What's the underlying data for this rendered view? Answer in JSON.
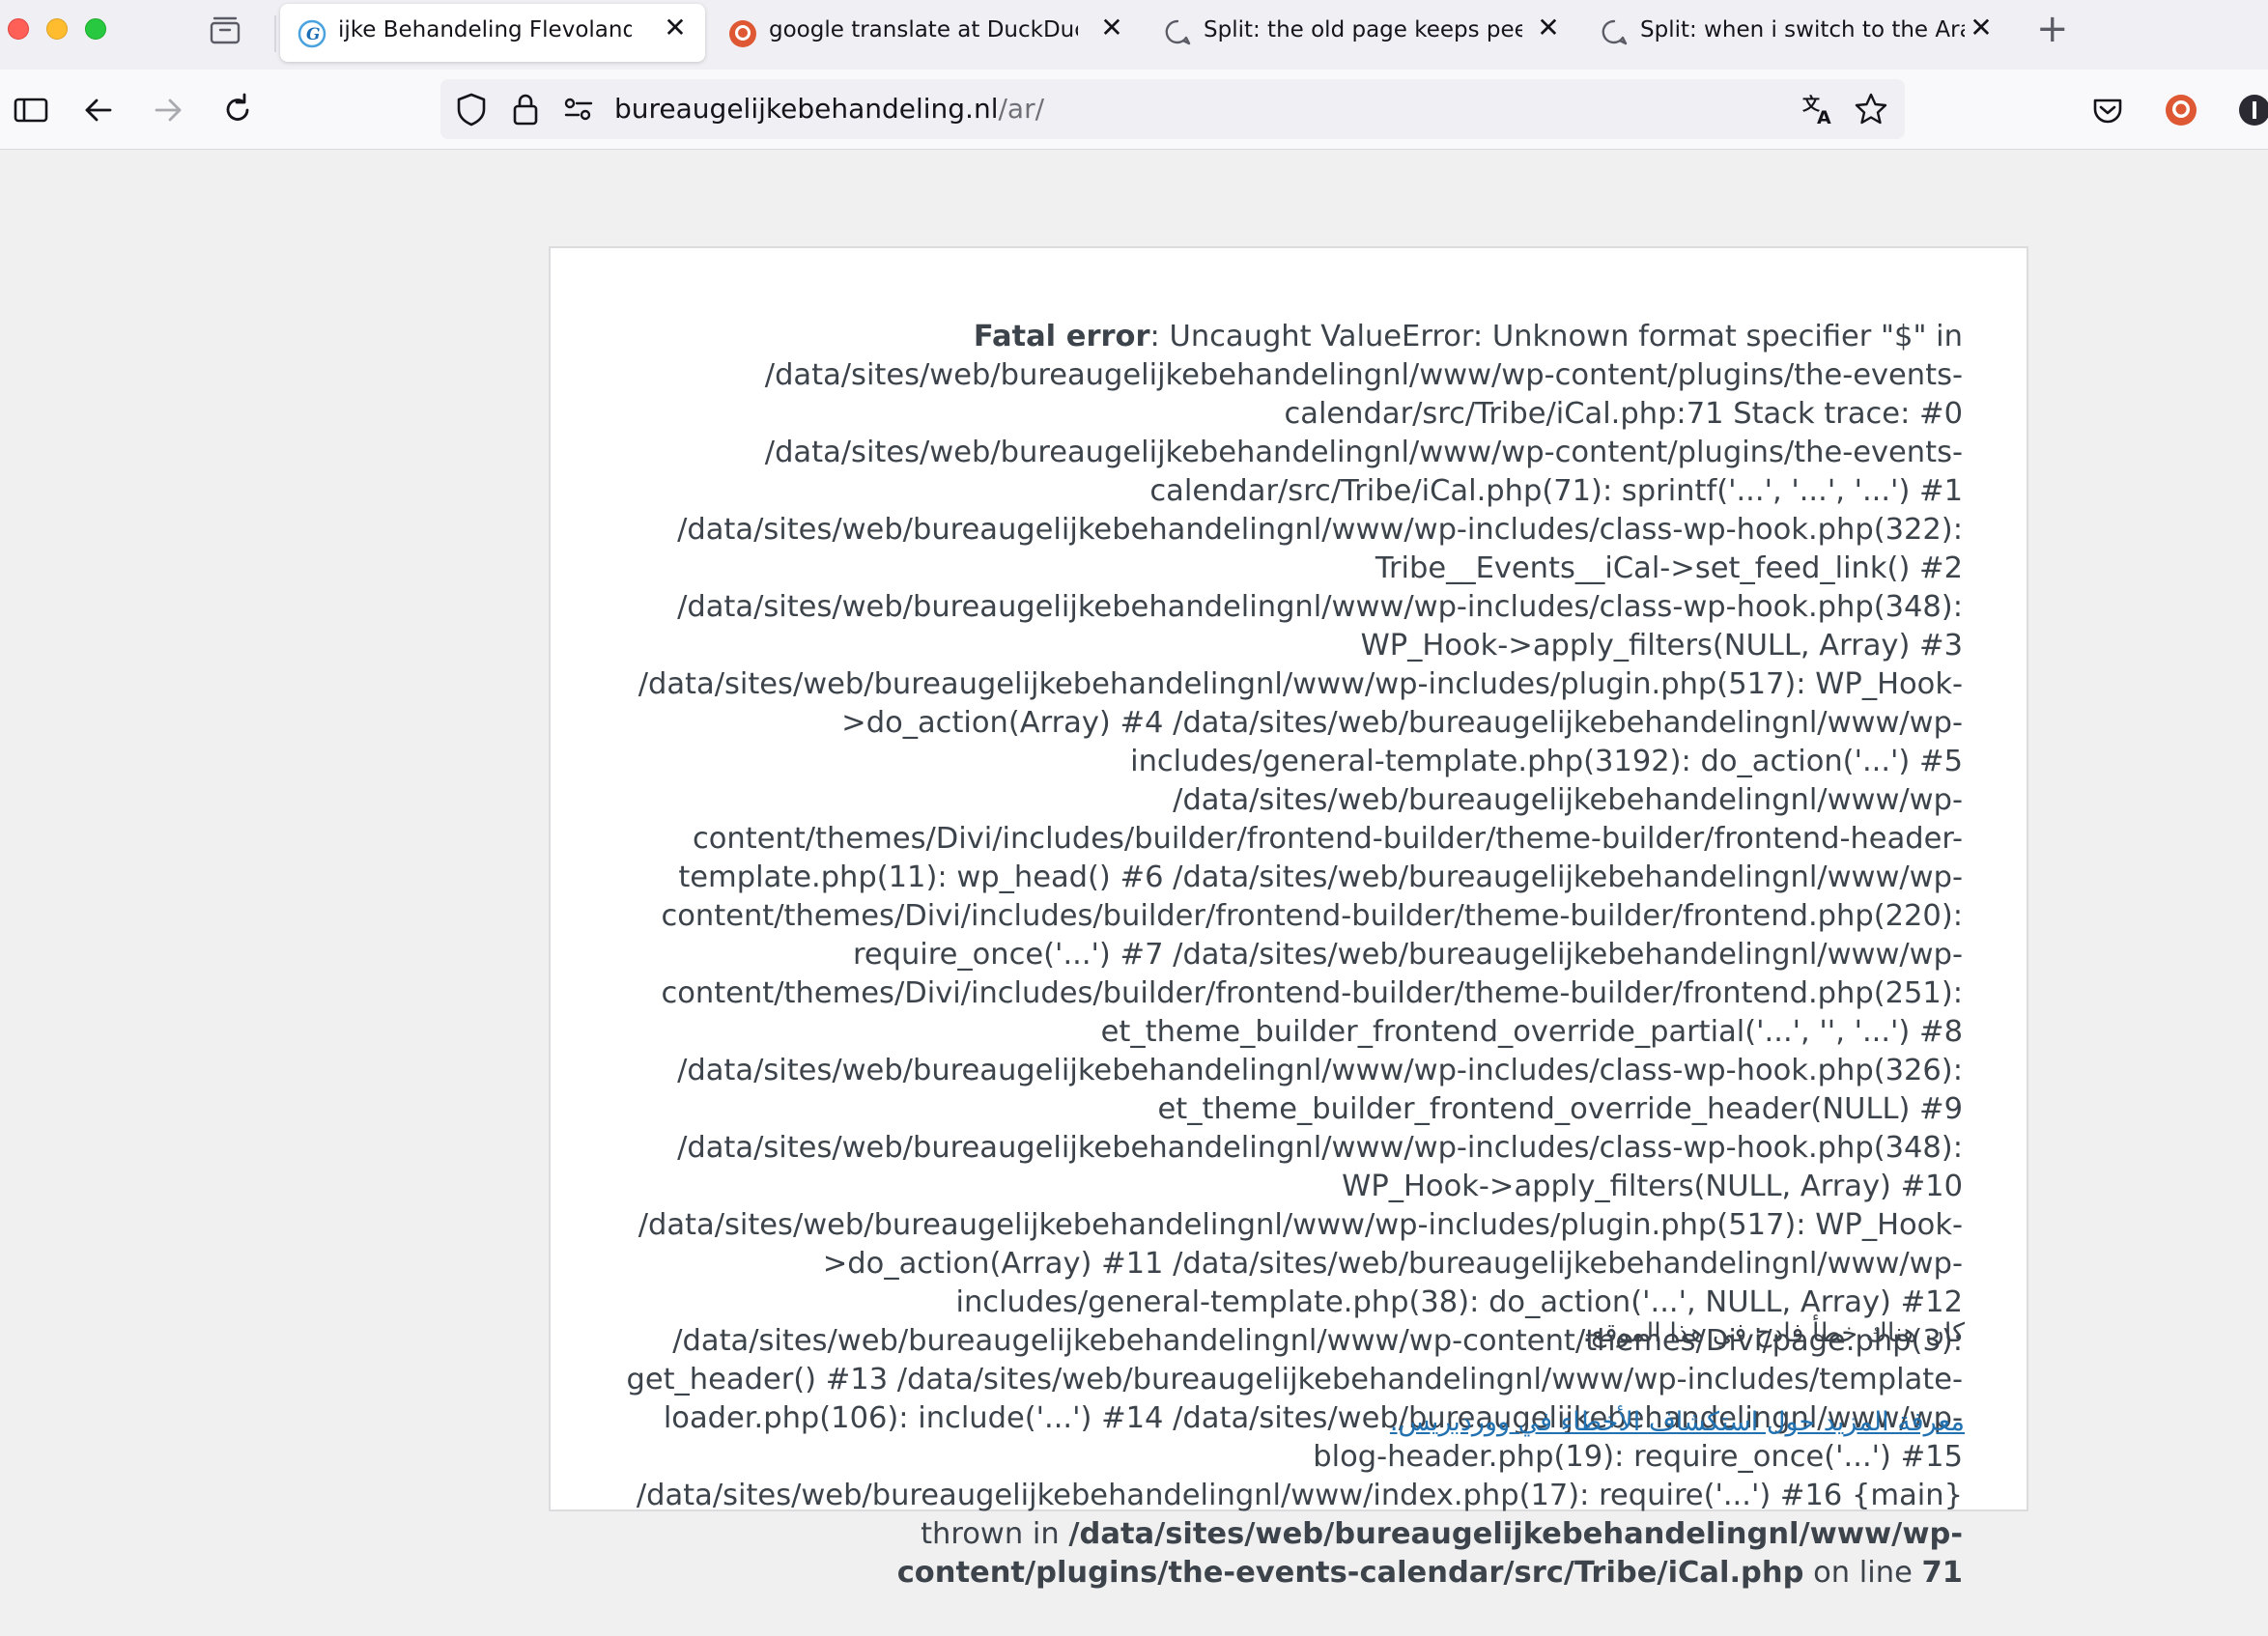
{
  "browser": {
    "tabs": [
      {
        "title": "ijke Behandeling Flevoland - بيت",
        "active": true
      },
      {
        "title": "google translate at DuckDuckGo",
        "active": false
      },
      {
        "title": "Split: the old page keeps peeping",
        "active": false
      },
      {
        "title": "Split: when i switch to the Arabic",
        "active": false
      }
    ],
    "new_tab_label": "+",
    "close_glyph": "✕",
    "url_domain": "bureaugelijkebehandeling.nl",
    "url_path": "/ar/"
  },
  "colors": {
    "accent_link": "#2271b1",
    "text": "#3c434a",
    "duckduckgo": "#de5833"
  },
  "icons": [
    "tab-overview-icon",
    "sidebar-icon",
    "back-icon",
    "forward-icon",
    "reload-icon",
    "shield-icon",
    "lock-icon",
    "permissions-icon",
    "translate-icon",
    "bookmark-star-icon",
    "pocket-icon",
    "duckduckgo-icon",
    "account-icon"
  ],
  "error": {
    "label": "Fatal error",
    "message": ": Uncaught ValueError: Unknown format specifier \"$\" in /data/sites/web/bureaugelijkebehandelingnl/www/wp-content/plugins/the-events-calendar/src/Tribe/iCal.php:71 Stack trace: #0 /data/sites/web/bureaugelijkebehandelingnl/www/wp-content/plugins/the-events-calendar/src/Tribe/iCal.php(71): sprintf('...', '...', '...') #1 /data/sites/web/bureaugelijkebehandelingnl/www/wp-includes/class-wp-hook.php(322): Tribe__Events__iCal->set_feed_link() #2 /data/sites/web/bureaugelijkebehandelingnl/www/wp-includes/class-wp-hook.php(348): WP_Hook->apply_filters(NULL, Array) #3 /data/sites/web/bureaugelijkebehandelingnl/www/wp-includes/plugin.php(517): WP_Hook->do_action(Array) #4 /data/sites/web/bureaugelijkebehandelingnl/www/wp-includes/general-template.php(3192): do_action('...') #5 /data/sites/web/bureaugelijkebehandelingnl/www/wp-content/themes/Divi/includes/builder/frontend-builder/theme-builder/frontend-header-template.php(11): wp_head() #6 /data/sites/web/bureaugelijkebehandelingnl/www/wp-content/themes/Divi/includes/builder/frontend-builder/theme-builder/frontend.php(220): require_once('...') #7 /data/sites/web/bureaugelijkebehandelingnl/www/wp-content/themes/Divi/includes/builder/frontend-builder/theme-builder/frontend.php(251): et_theme_builder_frontend_override_partial('...', '', '...') #8 /data/sites/web/bureaugelijkebehandelingnl/www/wp-includes/class-wp-hook.php(326): et_theme_builder_frontend_override_header(NULL) #9 /data/sites/web/bureaugelijkebehandelingnl/www/wp-includes/class-wp-hook.php(348): WP_Hook->apply_filters(NULL, Array) #10 /data/sites/web/bureaugelijkebehandelingnl/www/wp-includes/plugin.php(517): WP_Hook->do_action(Array) #11 /data/sites/web/bureaugelijkebehandelingnl/www/wp-includes/general-template.php(38): do_action('...', NULL, Array) #12 /data/sites/web/bureaugelijkebehandelingnl/www/wp-content/themes/Divi/page.php(3): get_header() #13 /data/sites/web/bureaugelijkebehandelingnl/www/wp-includes/template-loader.php(106): include('...') #14 /data/sites/web/bureaugelijkebehandelingnl/www/wp-blog-header.php(19): require_once('...') #15 /data/sites/web/bureaugelijkebehandelingnl/www/index.php(17): require('...') #16 {main} thrown",
    "in_label": " in ",
    "file": "/data/sites/web/bureaugelijkebehandelingnl/www/wp-content/plugins/the-events-calendar/src/Tribe/iCal.php",
    "on_line_label": " on line ",
    "line": "71"
  },
  "notice": {
    "critical_message": "كان هناك خطأ فادح في هذا الموقع.",
    "learn_more_link": "معرفة المزيد حول استكشاف الأخطاء في ووردبريس."
  }
}
